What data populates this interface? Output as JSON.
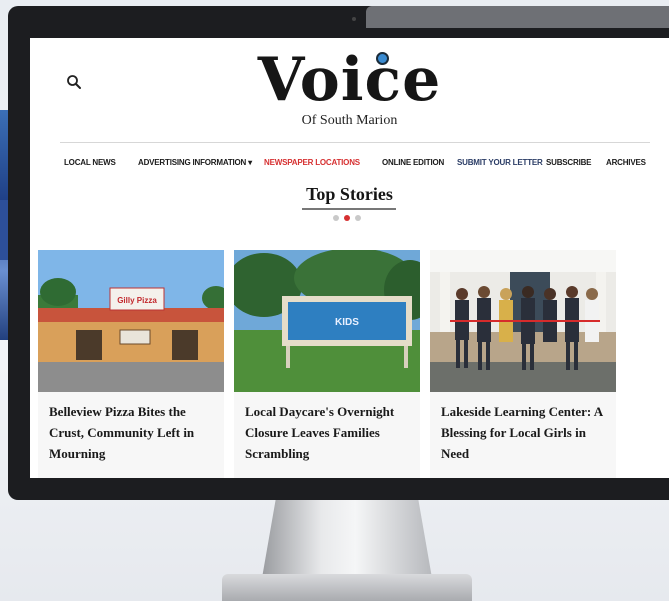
{
  "site": {
    "logo": "Voice",
    "tagline": "Of South Marion"
  },
  "nav": {
    "items": [
      {
        "label": "LOCAL NEWS"
      },
      {
        "label": "ADVERTISING INFORMATION ▾"
      },
      {
        "label": "NEWSPAPER LOCATIONS"
      },
      {
        "label": "ONLINE EDITION"
      },
      {
        "label": "SUBMIT YOUR LETTER"
      },
      {
        "label": "SUBSCRIBE"
      },
      {
        "label": "ARCHIVES"
      }
    ],
    "active_color": "#d63031"
  },
  "top_stories": {
    "title": "Top Stories",
    "carousel_active_index": 1,
    "carousel_count": 3,
    "cards": [
      {
        "title": "Belleview Pizza Bites the Crust, Community Left in Mourning",
        "sign": "Gilly Pizza"
      },
      {
        "title": "Local Daycare's Overnight Closure Leaves Families Scrambling",
        "sign": "KIDS"
      },
      {
        "title": "Lakeside Learning Center: A Blessing for Local Girls in Need"
      }
    ]
  },
  "colors": {
    "accent": "#d63031",
    "logo_dot": "#3a8bd1",
    "bezel": "#1c1d20"
  }
}
